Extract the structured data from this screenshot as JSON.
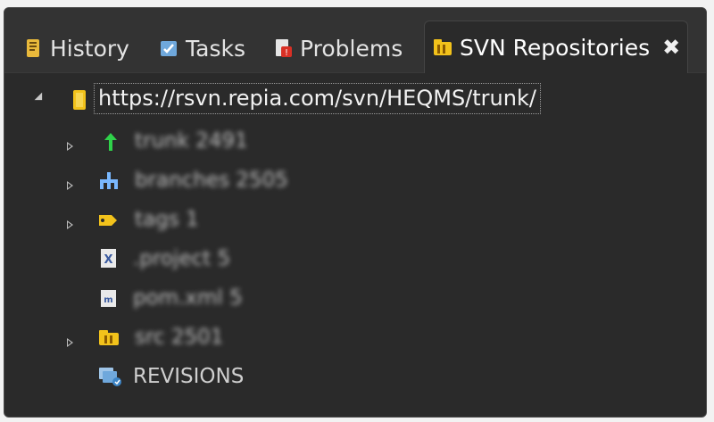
{
  "tabs": [
    {
      "label": "History",
      "icon": "history-icon"
    },
    {
      "label": "Tasks",
      "icon": "tasks-icon"
    },
    {
      "label": "Problems",
      "icon": "problems-icon"
    },
    {
      "label": "SVN Repositories",
      "icon": "svn-repositories-icon",
      "active": true,
      "close": "✖"
    }
  ],
  "tree": {
    "root": {
      "label": "https://rsvn.repia.com/svn/HEQMS/trunk/",
      "icon": "repository-folder-icon",
      "expanded": true
    },
    "children": [
      {
        "label": "trunk 2491",
        "icon": "trunk-arrow-icon",
        "expandable": true,
        "blurred": true
      },
      {
        "label": "branches 2505",
        "icon": "branches-icon",
        "expandable": true,
        "blurred": true
      },
      {
        "label": "tags 1",
        "icon": "tags-icon",
        "expandable": true,
        "blurred": true
      },
      {
        "label": ".project 5",
        "icon": "xml-file-icon",
        "expandable": false,
        "blurred": true
      },
      {
        "label": "pom.xml 5",
        "icon": "maven-file-icon",
        "expandable": false,
        "blurred": true
      },
      {
        "label": "src 2501",
        "icon": "source-folder-icon",
        "expandable": true,
        "blurred": true
      },
      {
        "label": "REVISIONS",
        "icon": "revisions-icon",
        "expandable": false,
        "blurred": false
      }
    ]
  },
  "colors": {
    "panel_bg": "#2a2a2a",
    "tabbar_bg": "#333333",
    "text": "#e3e3e3",
    "folder": "#f2c21b",
    "trunk_arrow": "#2fd24a",
    "branches": "#79b8ff"
  }
}
